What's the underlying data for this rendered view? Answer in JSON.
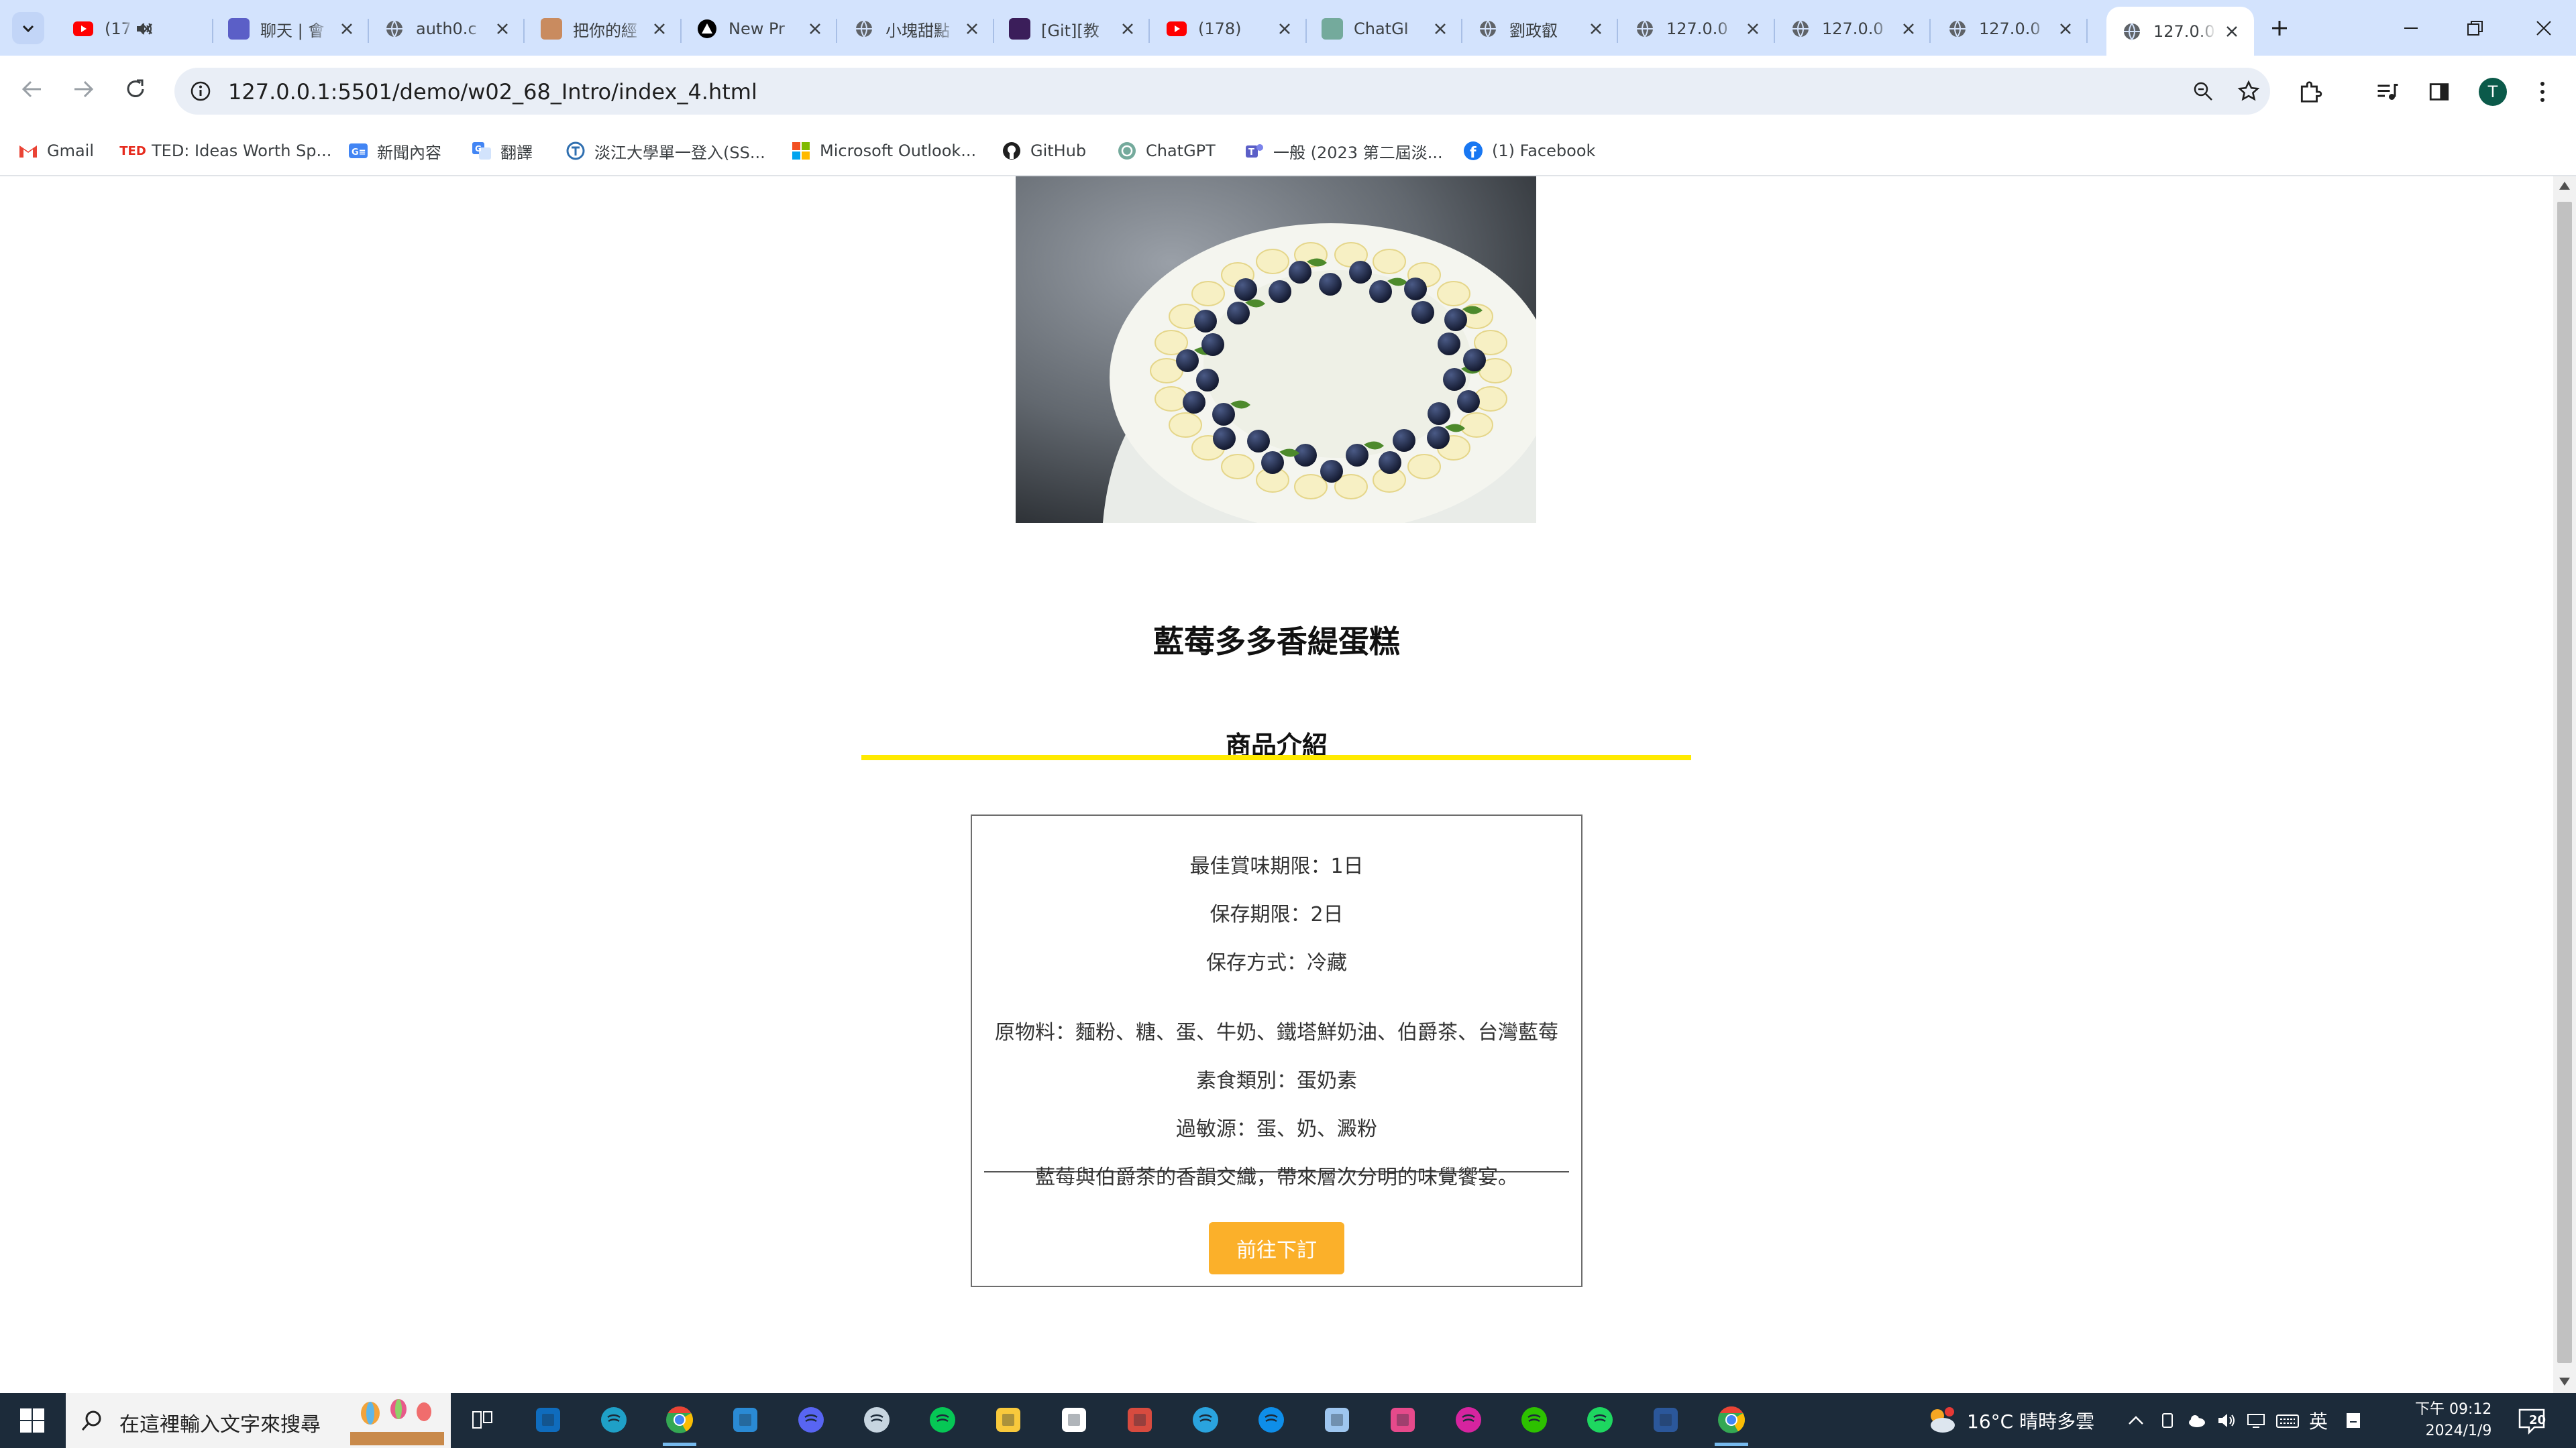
{
  "browser": {
    "tabs": [
      {
        "title": "(17",
        "icon": "youtube-icon",
        "color": "#ff0000"
      },
      {
        "title": "聊天 | 會",
        "icon": "teams-icon",
        "color": "#5b5fc7"
      },
      {
        "title": "auth0.c",
        "icon": "globe-icon",
        "color": "#5f6368"
      },
      {
        "title": "把你的經",
        "icon": "image-icon",
        "color": "#c98b5f"
      },
      {
        "title": "New Pr",
        "icon": "triangle-logo-icon",
        "color": "#000000"
      },
      {
        "title": "小塊甜點",
        "icon": "globe-icon",
        "color": "#5f6368"
      },
      {
        "title": "[Git][教",
        "icon": "dark-site-icon",
        "color": "#3b1e5a"
      },
      {
        "title": "(178)",
        "icon": "youtube-icon",
        "color": "#ff0000"
      },
      {
        "title": "ChatGI",
        "icon": "chatgpt-icon",
        "color": "#74aa9c"
      },
      {
        "title": "劉政叡",
        "icon": "globe-icon",
        "color": "#5f6368"
      },
      {
        "title": "127.0.0",
        "icon": "globe-icon",
        "color": "#5f6368"
      },
      {
        "title": "127.0.0",
        "icon": "globe-icon",
        "color": "#5f6368"
      },
      {
        "title": "127.0.0",
        "icon": "globe-icon",
        "color": "#5f6368"
      },
      {
        "title": "127.0.0",
        "icon": "globe-icon",
        "color": "#5f6368",
        "active": true
      }
    ],
    "url": "127.0.0.1:5501/demo/w02_68_Intro/index_4.html",
    "profile_initial": "T",
    "bookmarks": [
      {
        "label": "Gmail",
        "icon": "gmail-icon"
      },
      {
        "label": "TED: Ideas Worth Sp...",
        "icon": "ted-icon"
      },
      {
        "label": "新聞內容",
        "icon": "news-icon"
      },
      {
        "label": "翻譯",
        "icon": "translate-icon"
      },
      {
        "label": "淡江大學單一登入(SS...",
        "icon": "tku-icon"
      },
      {
        "label": "Microsoft Outlook...",
        "icon": "microsoft-icon"
      },
      {
        "label": "GitHub",
        "icon": "github-icon"
      },
      {
        "label": "ChatGPT",
        "icon": "chatgpt-icon"
      },
      {
        "label": "一般 (2023 第二屆淡...",
        "icon": "teams-icon"
      },
      {
        "label": "(1) Facebook",
        "icon": "facebook-icon"
      }
    ]
  },
  "page": {
    "product_title": "藍莓多多香緹蛋糕",
    "section_title": "商品介紹",
    "details": {
      "best_before": "最佳賞味期限：1日",
      "storage_period": "保存期限：2日",
      "storage_method": "保存方式：冷藏",
      "ingredients": "原物料：麵粉、糖、蛋、牛奶、鐵塔鮮奶油、伯爵茶、台灣藍莓",
      "vegetarian_type": "素食類別：蛋奶素",
      "allergens": "過敏源：蛋、奶、澱粉",
      "description": "藍莓與伯爵茶的香韻交織，帶來層次分明的味覺饗宴。"
    },
    "order_button": "前往下訂",
    "colors": {
      "accent_line": "#ffea00",
      "button": "#fbb02a"
    }
  },
  "taskbar": {
    "search_placeholder": "在這裡輸入文字來搜尋",
    "weather": "16°C  晴時多雲",
    "ime": "英",
    "time": "下午 09:12",
    "date": "2024/1/9",
    "notification_count": "20",
    "apps": [
      "task-view-icon",
      "outlook-icon",
      "edge-icon",
      "chrome-icon",
      "vscode-icon",
      "discord-icon",
      "steam-icon",
      "line-icon",
      "file-explorer-icon",
      "capcut-icon",
      "git-app-icon",
      "telegram-icon",
      "teamviewer-icon",
      "notepad-icon",
      "paint-icon",
      "instagram-icon",
      "wechat-icon",
      "spotify-icon",
      "word-icon",
      "chrome-icon"
    ]
  }
}
